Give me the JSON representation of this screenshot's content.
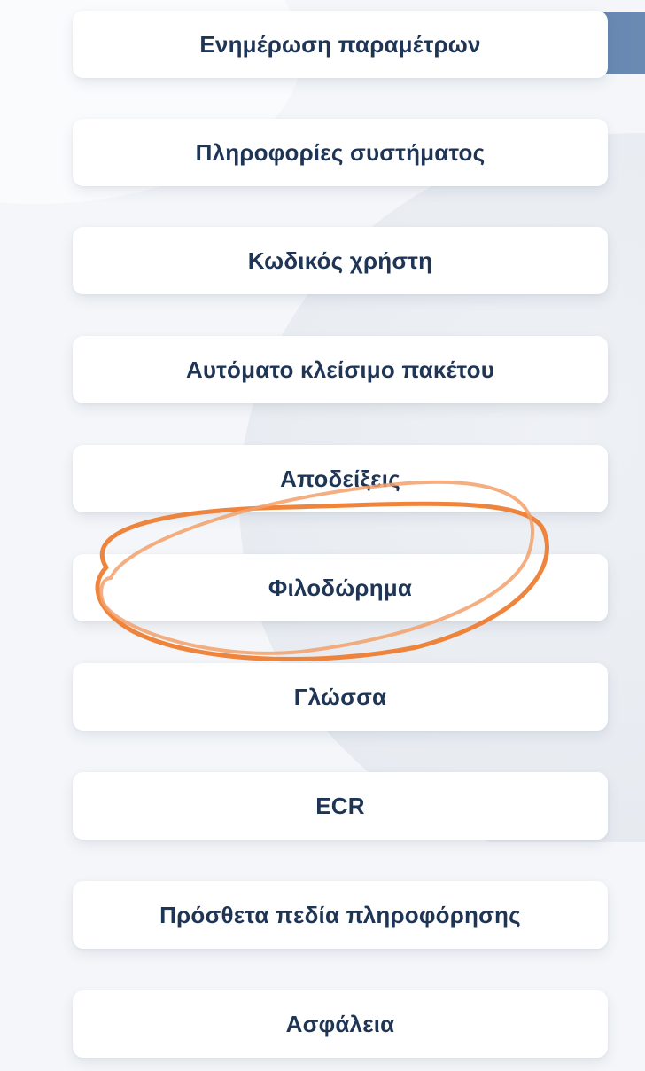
{
  "menu": {
    "items": [
      {
        "label": "Ενημέρωση παραμέτρων"
      },
      {
        "label": "Πληροφορίες συστήματος"
      },
      {
        "label": "Κωδικός χρήστη"
      },
      {
        "label": "Αυτόματο κλείσιμο πακέτου"
      },
      {
        "label": "Αποδείξεις"
      },
      {
        "label": "Φιλοδώρημα"
      },
      {
        "label": "Γλώσσα"
      },
      {
        "label": "ECR"
      },
      {
        "label": "Πρόσθετα πεδία πληροφόρησης"
      },
      {
        "label": "Ασφάλεια"
      }
    ]
  },
  "colors": {
    "header_band": "#6f8db6",
    "label_text": "#1f3556",
    "annotation_stroke": "#ee7b2c"
  },
  "annotation": {
    "type": "hand-drawn-ellipse",
    "highlighted_item": "Φιλοδώρημα"
  }
}
